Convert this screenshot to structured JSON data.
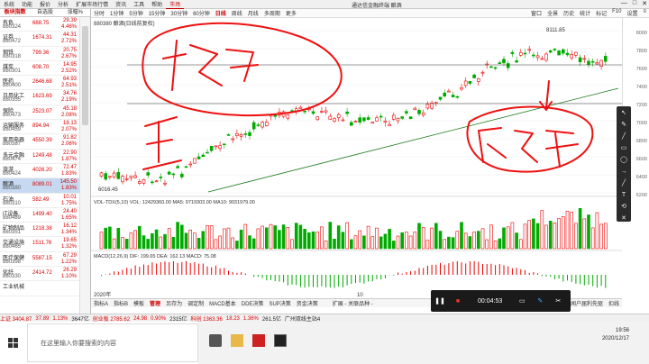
{
  "menubar": {
    "items": [
      "系统",
      "功能",
      "报价",
      "分析",
      "扩展市场行情",
      "资讯",
      "工具",
      "帮助",
      "市场"
    ],
    "title": "通达信金融终端 酿酒",
    "active_index": 8,
    "win_ctrl": [
      "—",
      "□",
      "✕"
    ]
  },
  "sidebar": {
    "tabs": [
      "板块指数",
      "自选股",
      "涨幅%"
    ],
    "rows": [
      {
        "name": "有色",
        "code": "880324",
        "price": "688.75",
        "c1": "29.39",
        "c2": "4.46%"
      },
      {
        "name": "证券",
        "code": "880472",
        "price": "1674.31",
        "c1": "44.31",
        "c2": "2.72%"
      },
      {
        "name": "钢铁",
        "code": "880318",
        "price": "799.36",
        "c1": "20.75",
        "c2": "2.67%"
      },
      {
        "name": "煤炭",
        "code": "880301",
        "price": "608.70",
        "c1": "14.95",
        "c2": "2.52%"
      },
      {
        "name": "医药",
        "code": "880400",
        "price": "2646.68",
        "c1": "64.93",
        "c2": "2.51%"
      },
      {
        "name": "日用化工",
        "code": "880355",
        "price": "1623.69",
        "c1": "34.76",
        "c2": "2.19%"
      },
      {
        "name": "保险",
        "code": "880473",
        "price": "2523.07",
        "c1": "45.18",
        "c2": "2.08%"
      },
      {
        "name": "运输服务",
        "code": "880459",
        "price": "894.94",
        "c1": "18.13",
        "c2": "2.07%"
      },
      {
        "name": "家用电器",
        "code": "880387",
        "price": "4550.39",
        "c1": "91.82",
        "c2": "2.06%"
      },
      {
        "name": "多元金融",
        "code": "880474",
        "price": "1249.48",
        "c1": "22.90",
        "c2": "1.87%"
      },
      {
        "name": "旅游",
        "code": "880424",
        "price": "4026.20",
        "c1": "72.47",
        "c2": "1.83%"
      },
      {
        "name": "酿酒",
        "code": "880380",
        "price": "8089.01",
        "c1": "145.50",
        "c2": "1.83%"
      },
      {
        "name": "石油",
        "code": "880310",
        "price": "582.49",
        "c1": "10.01",
        "c2": "1.75%"
      },
      {
        "name": "IT设备",
        "code": "880489",
        "price": "1499.40",
        "c1": "24.40",
        "c2": "1.65%"
      },
      {
        "name": "矿物制品",
        "code": "880351",
        "price": "1218.38",
        "c1": "16.12",
        "c2": "1.34%"
      },
      {
        "name": "交通设施",
        "code": "880465",
        "price": "1511.76",
        "c1": "19.65",
        "c2": "1.32%"
      },
      {
        "name": "医疗保健",
        "code": "880398",
        "price": "5587.15",
        "c1": "67.29",
        "c2": "1.22%"
      },
      {
        "name": "化纤",
        "code": "880330",
        "price": "2414.72",
        "c1": "26.29",
        "c2": "1.10%"
      },
      {
        "name": "工业机械",
        "code": "",
        "price": "",
        "c1": "",
        "c2": ""
      }
    ],
    "selected_index": 11
  },
  "toolbar": {
    "items": [
      "分时",
      "1分钟",
      "5分钟",
      "15分钟",
      "30分钟",
      "60分钟",
      "日线",
      "周线",
      "月线",
      "多周期",
      "更多"
    ],
    "active_index": 6,
    "right_items": [
      "窗口",
      "全景",
      "历史",
      "统计",
      "标记",
      "F10",
      "设置",
      "≡"
    ]
  },
  "chart": {
    "stock_label": "880380  酿酒(日线前复权)",
    "high_label": "8111.85",
    "low_label": "6016.45",
    "y_ticks": [
      "8000",
      "7800",
      "7600",
      "7400",
      "7200",
      "7000",
      "6800",
      "6600",
      "6400",
      "6200"
    ],
    "vol_label": "VOL-TDX(5,10)  VOL: 12429360.00  MA5: 9719303.00  MA10: 9031979.00",
    "macd_label": "MACD(12,26,9)  DIF: 199.65  DEA: 162.13  MACD: 75.08",
    "date_label": "2020年",
    "month_label": "10",
    "right_tab": "扣线"
  },
  "bottom_tabs": {
    "items": [
      "指标A",
      "指标B",
      "模板",
      "管理",
      "另存为",
      "调定制",
      "MACD基本",
      "DDE决策",
      "SUP决策",
      "资金决策"
    ],
    "active_index": 3,
    "extra": "扩展 - 关联品种 -",
    "right": "新闻户届利先驱"
  },
  "status": {
    "items": [
      {
        "t": "上证 3404.87",
        "c": "red"
      },
      {
        "t": "37.89",
        "c": "red"
      },
      {
        "t": "1.13%",
        "c": "red"
      },
      {
        "t": "3647亿",
        "c": ""
      },
      {
        "t": "创业板 2785.62",
        "c": "red"
      },
      {
        "t": "24.98",
        "c": "red"
      },
      {
        "t": "0.90%",
        "c": "red"
      },
      {
        "t": "2315亿",
        "c": ""
      },
      {
        "t": "科创 1363.36",
        "c": "red"
      },
      {
        "t": "18.23",
        "c": "red"
      },
      {
        "t": "1.36%",
        "c": "red"
      },
      {
        "t": "261.5亿",
        "c": ""
      },
      {
        "t": "广州双线主站4",
        "c": ""
      }
    ]
  },
  "annotations": {
    "a1": "持股",
    "a2": "平",
    "a3": "反转"
  },
  "recorder": {
    "time": "00:04:53",
    "pause": "❚❚",
    "stop": "■",
    "b1": "▭",
    "b2": "✎",
    "b3": "✂"
  },
  "pen_panel": [
    "↖",
    "✎",
    "╱",
    "▭",
    "◯",
    "→",
    "╱",
    "T",
    "⟲",
    "✕"
  ],
  "taskbar": {
    "search_placeholder": "在这里输入你要搜索的内容",
    "time": "19:56",
    "date": "2020/12/17"
  }
}
